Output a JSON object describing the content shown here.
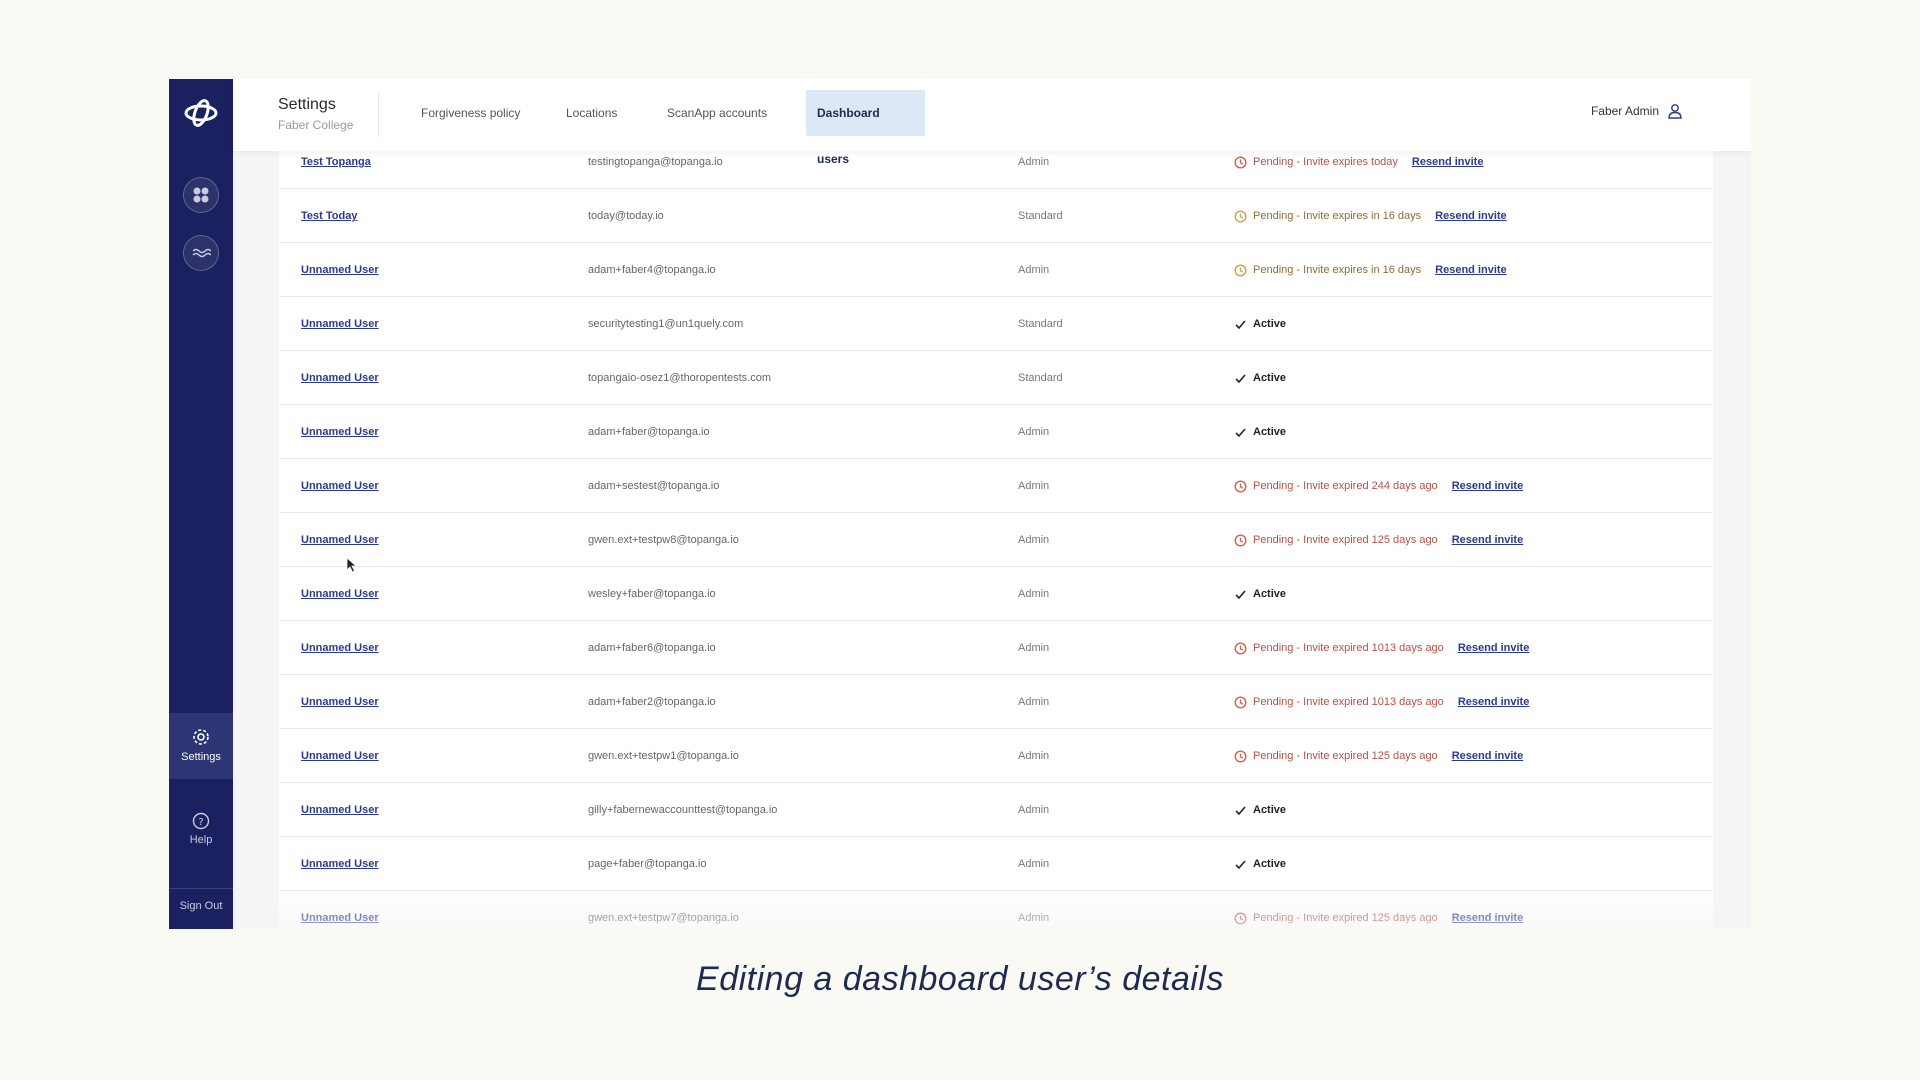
{
  "header": {
    "title": "Settings",
    "subtitle": "Faber College",
    "tabs": [
      {
        "label": "Forgiveness policy"
      },
      {
        "label": "Locations"
      },
      {
        "label": "ScanApp accounts"
      },
      {
        "label": "Dashboard users"
      }
    ],
    "active_tab": "Dashboard users",
    "user_name": "Faber Admin"
  },
  "sidebar": {
    "settings_label": "Settings",
    "help_label": "Help",
    "signout_label": "Sign Out"
  },
  "users": [
    {
      "name": "Test Topanga",
      "email": "testingtopanga@topanga.io",
      "role": "Admin",
      "status": "Pending - Invite expires today",
      "status_type": "pending",
      "resend": "Resend invite"
    },
    {
      "name": "Test Today",
      "email": "today@today.io",
      "role": "Standard",
      "status": "Pending - Invite expires in 16 days",
      "status_type": "pending-soon",
      "resend": "Resend invite"
    },
    {
      "name": "Unnamed User",
      "email": "adam+faber4@topanga.io",
      "role": "Admin",
      "status": "Pending - Invite expires in 16 days",
      "status_type": "pending-soon",
      "resend": "Resend invite"
    },
    {
      "name": "Unnamed User",
      "email": "securitytesting1@un1quely.com",
      "role": "Standard",
      "status": "Active",
      "status_type": "active",
      "resend": ""
    },
    {
      "name": "Unnamed User",
      "email": "topangaio-osez1@thoropentests.com",
      "role": "Standard",
      "status": "Active",
      "status_type": "active",
      "resend": ""
    },
    {
      "name": "Unnamed User",
      "email": "adam+faber@topanga.io",
      "role": "Admin",
      "status": "Active",
      "status_type": "active",
      "resend": ""
    },
    {
      "name": "Unnamed User",
      "email": "adam+sestest@topanga.io",
      "role": "Admin",
      "status": "Pending - Invite expired 244 days ago",
      "status_type": "pending",
      "resend": "Resend invite"
    },
    {
      "name": "Unnamed User",
      "email": "gwen.ext+testpw8@topanga.io",
      "role": "Admin",
      "status": "Pending - Invite expired 125 days ago",
      "status_type": "pending",
      "resend": "Resend invite"
    },
    {
      "name": "Unnamed User",
      "email": "wesley+faber@topanga.io",
      "role": "Admin",
      "status": "Active",
      "status_type": "active",
      "resend": ""
    },
    {
      "name": "Unnamed User",
      "email": "adam+faber6@topanga.io",
      "role": "Admin",
      "status": "Pending - Invite expired 1013 days ago",
      "status_type": "pending",
      "resend": "Resend invite"
    },
    {
      "name": "Unnamed User",
      "email": "adam+faber2@topanga.io",
      "role": "Admin",
      "status": "Pending - Invite expired 1013 days ago",
      "status_type": "pending",
      "resend": "Resend invite"
    },
    {
      "name": "Unnamed User",
      "email": "gwen.ext+testpw1@topanga.io",
      "role": "Admin",
      "status": "Pending - Invite expired 125 days ago",
      "status_type": "pending",
      "resend": "Resend invite"
    },
    {
      "name": "Unnamed User",
      "email": "gilly+fabernewaccounttest@topanga.io",
      "role": "Admin",
      "status": "Active",
      "status_type": "active",
      "resend": ""
    },
    {
      "name": "Unnamed User",
      "email": "page+faber@topanga.io",
      "role": "Admin",
      "status": "Active",
      "status_type": "active",
      "resend": ""
    },
    {
      "name": "Unnamed User",
      "email": "gwen.ext+testpw7@topanga.io",
      "role": "Admin",
      "status": "Pending - Invite expired 125 days ago",
      "status_type": "pending",
      "resend": "Resend invite"
    }
  ],
  "icons": {
    "pending": "clock-icon",
    "active": "check-icon",
    "user": "user-icon",
    "settings": "gear-icon",
    "help": "question-icon"
  },
  "colors": {
    "sidebar": "#1b2160",
    "link": "#2c3a8c",
    "pending": "#b0524a",
    "active_tab_bg": "#dde8f7"
  },
  "caption": "Editing a dashboard user’s details"
}
